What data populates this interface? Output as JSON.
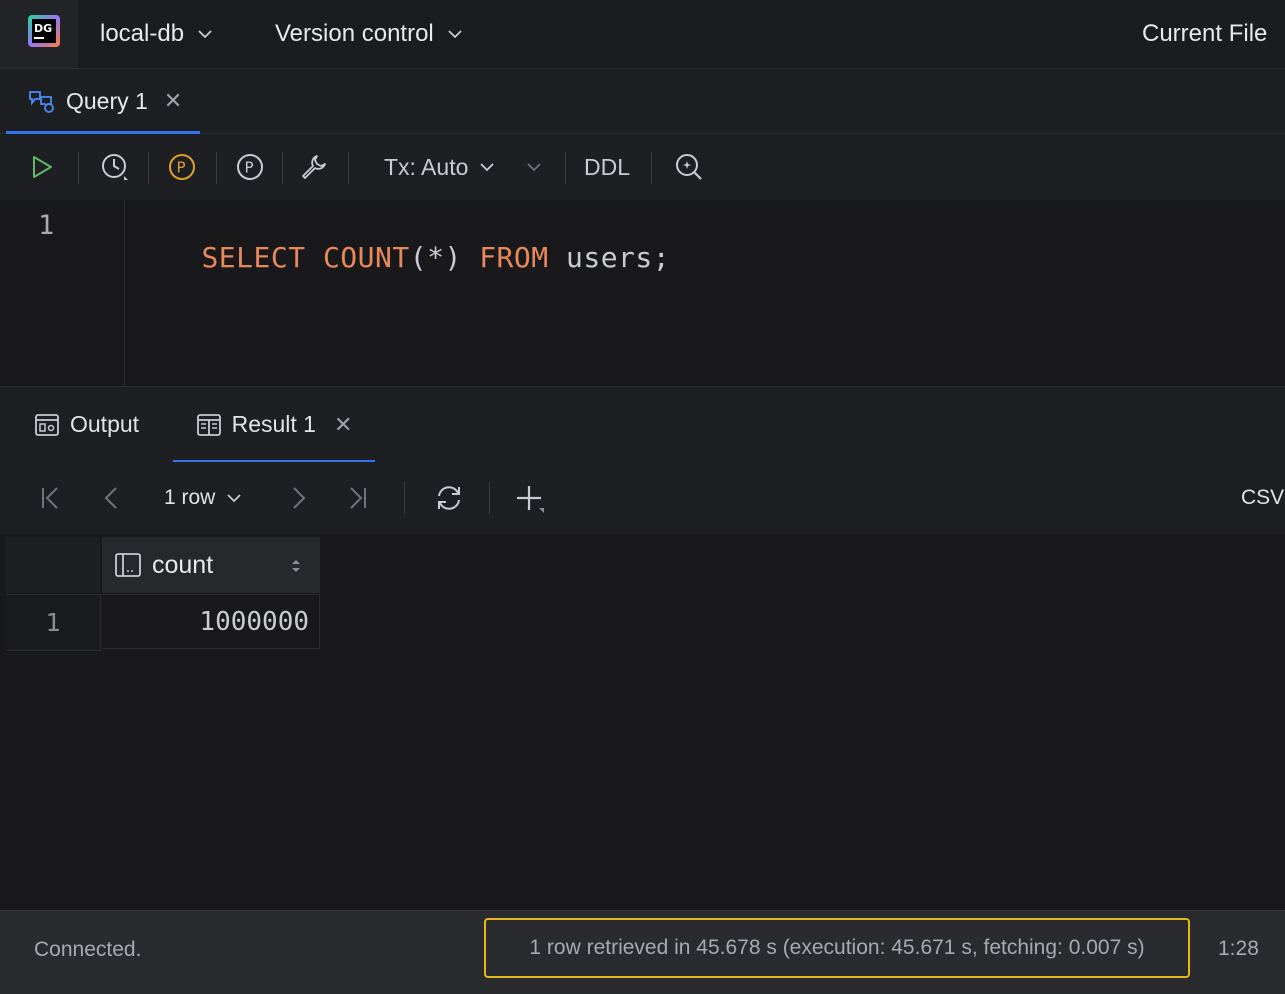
{
  "titlebar": {
    "logo_text": "DG",
    "project": "local-db",
    "vcs": "Version control",
    "run_config": "Current File"
  },
  "editor_tabs": [
    {
      "label": "Query 1",
      "active": true
    }
  ],
  "toolbar": {
    "tx_label": "Tx: Auto",
    "ddl_label": "DDL"
  },
  "editor": {
    "line_number": "1",
    "tokens": [
      {
        "text": "SELECT ",
        "kind": "keyword"
      },
      {
        "text": "COUNT",
        "kind": "keyword"
      },
      {
        "text": "(*) ",
        "kind": "plain"
      },
      {
        "text": "FROM ",
        "kind": "keyword"
      },
      {
        "text": "users;",
        "kind": "plain"
      }
    ]
  },
  "result_tabs": [
    {
      "label": "Output",
      "active": false
    },
    {
      "label": "Result 1",
      "active": true
    }
  ],
  "result_toolbar": {
    "rows_selector": "1 row",
    "export_label": "CSV"
  },
  "grid": {
    "columns": [
      {
        "name": "count"
      }
    ],
    "rows": [
      {
        "num": "1",
        "values": [
          "1000000"
        ]
      }
    ]
  },
  "statusbar": {
    "connection": "Connected.",
    "message": "1 row retrieved in 45.678 s (execution: 45.671 s, fetching: 0.007 s)",
    "caret_position": "1:28"
  },
  "colors": {
    "accent": "#3574f0",
    "keyword": "#e8895b",
    "run_green": "#5fb865",
    "explain_orange": "#e0a12c",
    "highlight_border": "#e4b81d"
  }
}
